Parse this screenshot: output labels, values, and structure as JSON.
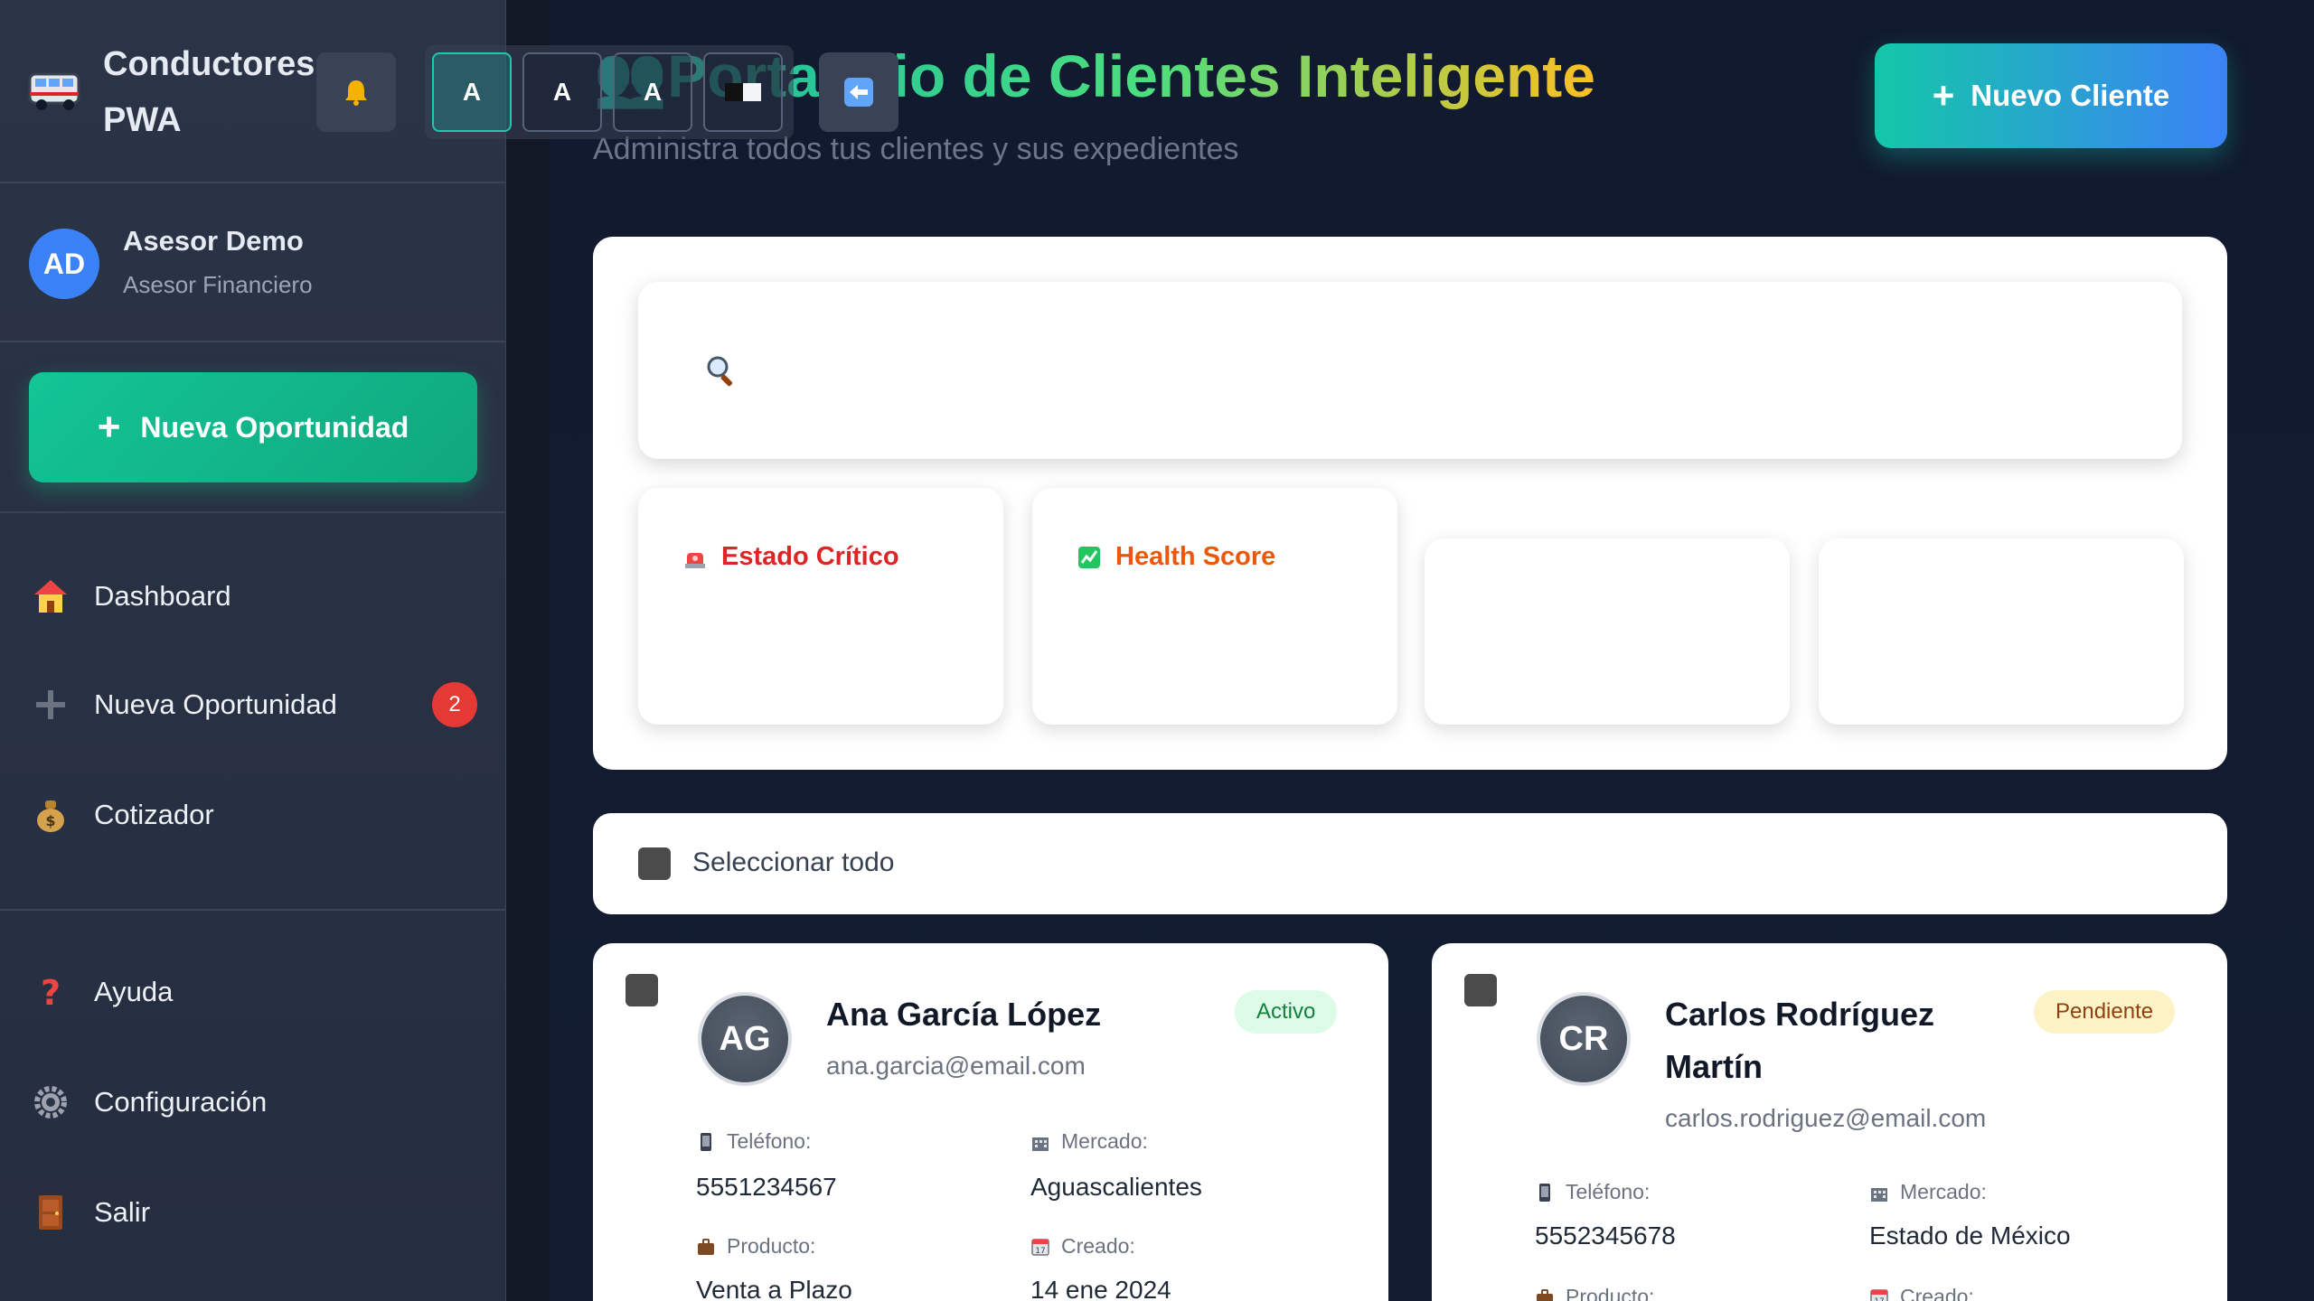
{
  "sidebar": {
    "brand": "Conductores PWA",
    "user": {
      "initials": "AD",
      "name": "Asesor Demo",
      "role": "Asesor Financiero"
    },
    "cta": "Nueva Oportunidad",
    "nav": [
      {
        "label": "Dashboard",
        "icon": "house-icon"
      },
      {
        "label": "Nueva Oportunidad",
        "icon": "plus-icon",
        "badge": "2"
      },
      {
        "label": "Cotizador",
        "icon": "money-bag-icon"
      }
    ],
    "bottom_nav": [
      {
        "label": "Ayuda",
        "icon": "question-icon"
      },
      {
        "label": "Configuración",
        "icon": "gear-icon"
      },
      {
        "label": "Salir",
        "icon": "door-icon"
      }
    ]
  },
  "font_controls": [
    "A",
    "A",
    "A"
  ],
  "header": {
    "title": "👥Portafolio de Clientes Inteligente",
    "subtitle": "Administra todos tus clientes y sus expedientes",
    "new_client": "Nuevo Cliente"
  },
  "filters": {
    "search_placeholder": "",
    "cards": [
      {
        "label": "Estado Crítico",
        "icon": "siren-icon",
        "color": "#dc2626"
      },
      {
        "label": "Health Score",
        "icon": "chart-icon",
        "color": "#ea580c"
      }
    ]
  },
  "select_all": "Seleccionar todo",
  "field_labels": {
    "phone": "Teléfono:",
    "market": "Mercado:",
    "product": "Producto:",
    "created": "Creado:"
  },
  "clients": [
    {
      "initials": "AG",
      "name": "Ana García López",
      "email": "ana.garcia@email.com",
      "status": "Activo",
      "phone": "5551234567",
      "market": "Aguascalientes",
      "product": "Venta a Plazo",
      "created": "14 ene 2024"
    },
    {
      "initials": "CR",
      "name": "Carlos Rodríguez Martín",
      "email": "carlos.rodriguez@email.com",
      "status": "Pendiente",
      "phone": "5552345678",
      "market": "Estado de México",
      "product": "",
      "created": ""
    }
  ],
  "colors": {
    "accent": "#14b8a6",
    "danger": "#e53935",
    "success": "#10b981"
  }
}
